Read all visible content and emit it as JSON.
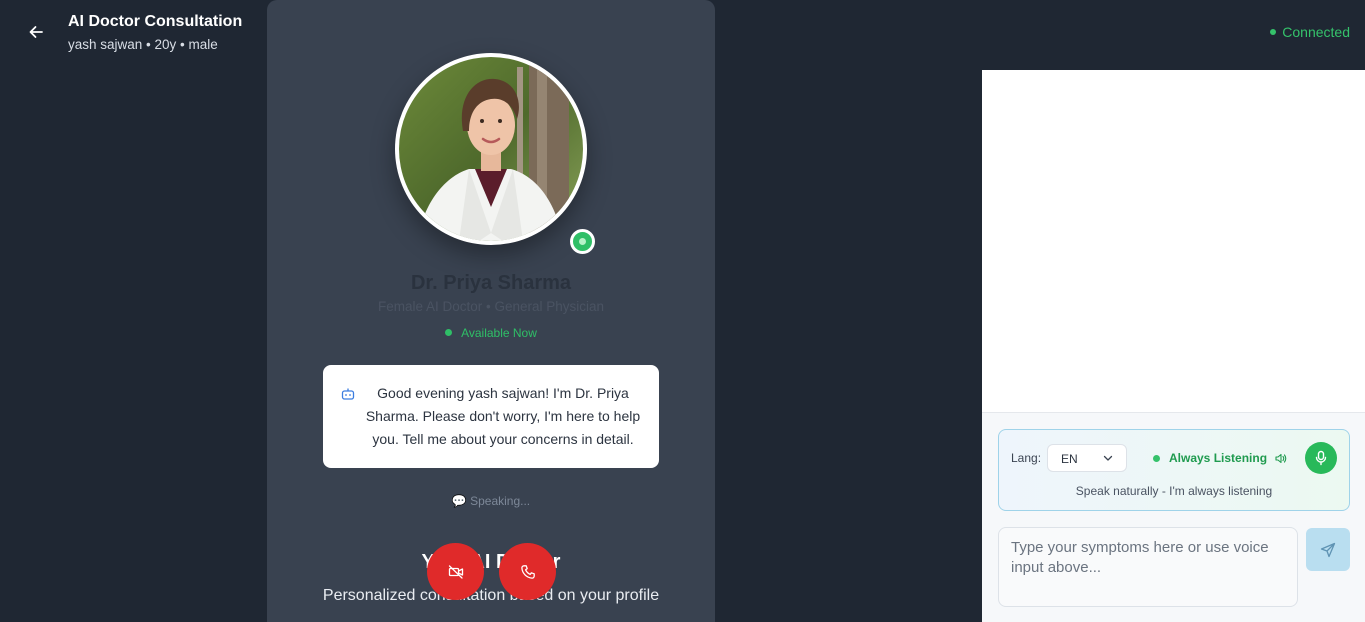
{
  "header": {
    "title": "AI Doctor Consultation",
    "subtitle": "yash sajwan • 20y • male",
    "status": "Connected",
    "back_icon": "arrow-left-icon"
  },
  "doctor": {
    "name": "Dr. Priya Sharma",
    "role": "Female AI Doctor • General Physician",
    "availability": "Available Now",
    "greeting": "Good evening yash sajwan! I'm Dr. Priya Sharma. Please don't worry, I'm here to help you. Tell me about your concerns in detail.",
    "speaking": "💬 Speaking...",
    "status_color": "#2fbf67"
  },
  "hero": {
    "title": "Your AI Doctor",
    "subtitle": "Personalized consultation based on your profile"
  },
  "controls": {
    "video_icon": "video-off-icon",
    "call_icon": "phone-icon",
    "button_color": "#e02a2a"
  },
  "voice": {
    "lang_label": "Lang:",
    "lang_value": "EN",
    "listening_label": "Always Listening",
    "hint": "Speak naturally - I'm always listening",
    "mic_icon": "microphone-icon"
  },
  "input": {
    "placeholder": "Type your symptoms here or use voice input above...",
    "send_icon": "send-icon"
  }
}
